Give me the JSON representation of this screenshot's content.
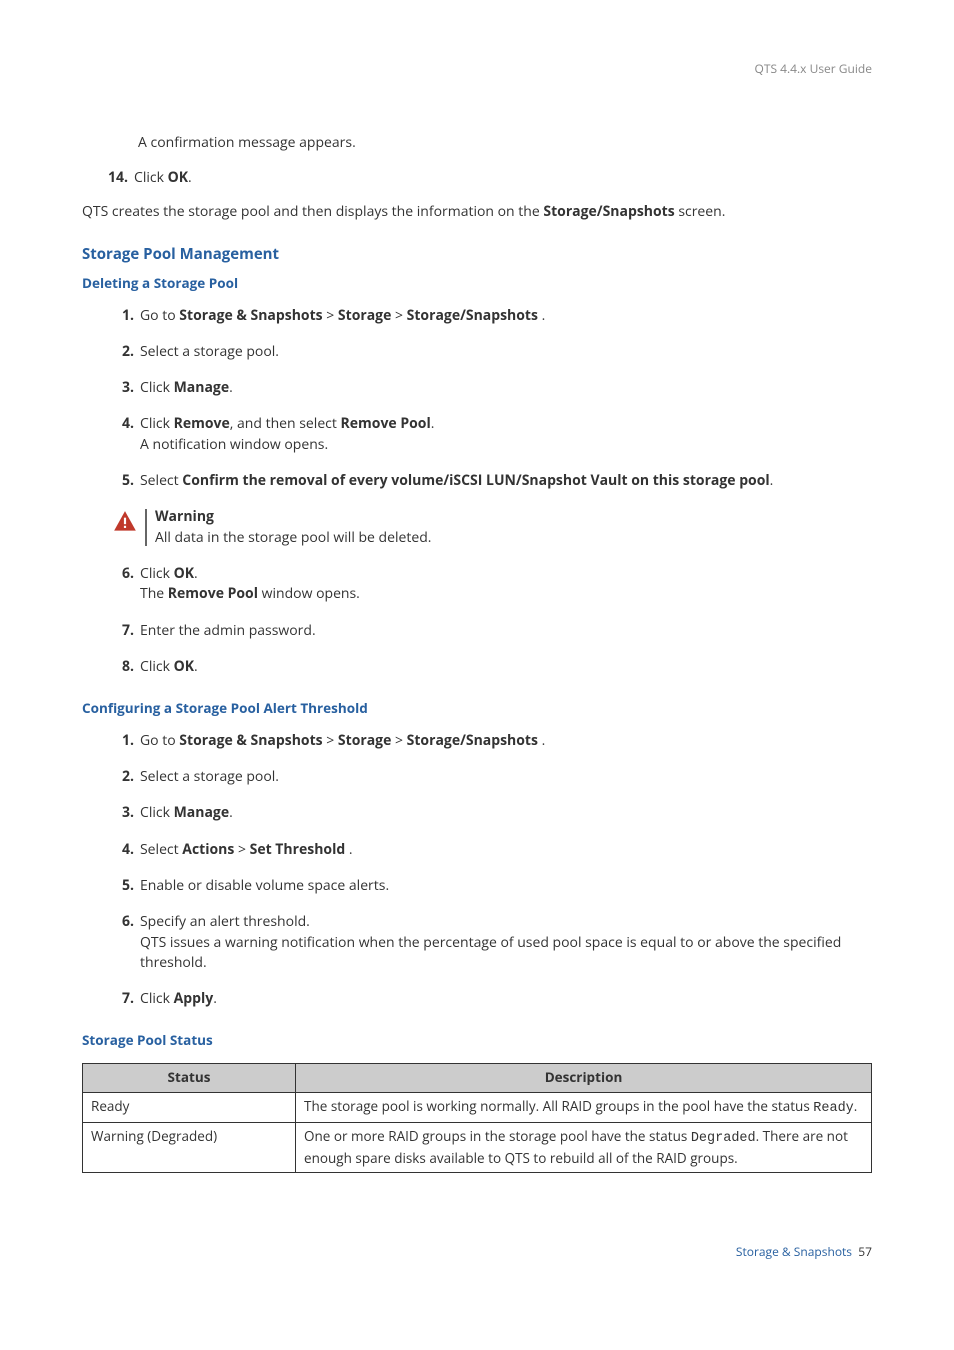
{
  "header": {
    "guide": "QTS 4.4.x User Guide"
  },
  "intro": {
    "confirm_msg": "A confirmation message appears.",
    "step14_num": "14.",
    "step14_text": "Click ",
    "step14_bold": "OK",
    "step14_end": ".",
    "creates_before": "QTS creates the storage pool and then displays the information on the ",
    "creates_bold": "Storage/Snapshots",
    "creates_after": " screen."
  },
  "h_management": "Storage Pool Management",
  "h_deleting": "Deleting a Storage Pool",
  "del": {
    "s1_pre": "Go to ",
    "s1_b1": "Storage & Snapshots",
    "s1_sep": " > ",
    "s1_b2": "Storage",
    "s1_b3": "Storage/Snapshots",
    "s1_end": " .",
    "s2": "Select a storage pool.",
    "s3_pre": "Click ",
    "s3_b": "Manage",
    "s3_end": ".",
    "s4_pre": "Click ",
    "s4_b1": "Remove",
    "s4_mid": ", and then select ",
    "s4_b2": "Remove Pool",
    "s4_end": ".",
    "s4_line2": "A notification window opens.",
    "s5_pre": "Select ",
    "s5_b": "Confirm the removal of every volume/iSCSI LUN/Snapshot Vault on this storage pool",
    "s5_end": ".",
    "warn_title": "Warning",
    "warn_text": "All data in the storage pool will be deleted.",
    "s6_pre": "Click ",
    "s6_b": "OK",
    "s6_end": ".",
    "s6_line2_pre": "The ",
    "s6_line2_b": "Remove Pool",
    "s6_line2_end": " window opens.",
    "s7": "Enter the admin password.",
    "s8_pre": "Click ",
    "s8_b": "OK",
    "s8_end": "."
  },
  "h_config": "Configuring a Storage Pool Alert Threshold",
  "cfg": {
    "s1_pre": "Go to ",
    "s1_b1": "Storage & Snapshots",
    "s1_sep": " > ",
    "s1_b2": "Storage",
    "s1_b3": "Storage/Snapshots",
    "s1_end": " .",
    "s2": "Select a storage pool.",
    "s3_pre": "Click ",
    "s3_b": "Manage",
    "s3_end": ".",
    "s4_pre": "Select ",
    "s4_b1": "Actions",
    "s4_sep": " > ",
    "s4_b2": "Set Threshold",
    "s4_end": " .",
    "s5": "Enable or disable volume space alerts.",
    "s6_l1": "Specify an alert threshold.",
    "s6_l2": "QTS issues a warning notification when the percentage of used pool space is equal to or above the specified threshold.",
    "s7_pre": "Click ",
    "s7_b": "Apply",
    "s7_end": "."
  },
  "h_status": "Storage Pool Status",
  "table": {
    "col1": "Status",
    "col2": "Description",
    "r1c1": "Ready",
    "r1c2_pre": "The storage pool is working normally. All RAID groups in the pool have the status ",
    "r1c2_code": "Ready",
    "r1c2_end": ".",
    "r2c1": "Warning (Degraded)",
    "r2c2_pre": "One or more RAID groups in the storage pool have the status ",
    "r2c2_code": "Degraded",
    "r2c2_mid": ". There are not enough spare disks available to QTS to rebuild all of the RAID groups."
  },
  "footer": {
    "section": "Storage & Snapshots",
    "page": "57"
  },
  "nums": {
    "n1": "1.",
    "n2": "2.",
    "n3": "3.",
    "n4": "4.",
    "n5": "5.",
    "n6": "6.",
    "n7": "7.",
    "n8": "8."
  }
}
